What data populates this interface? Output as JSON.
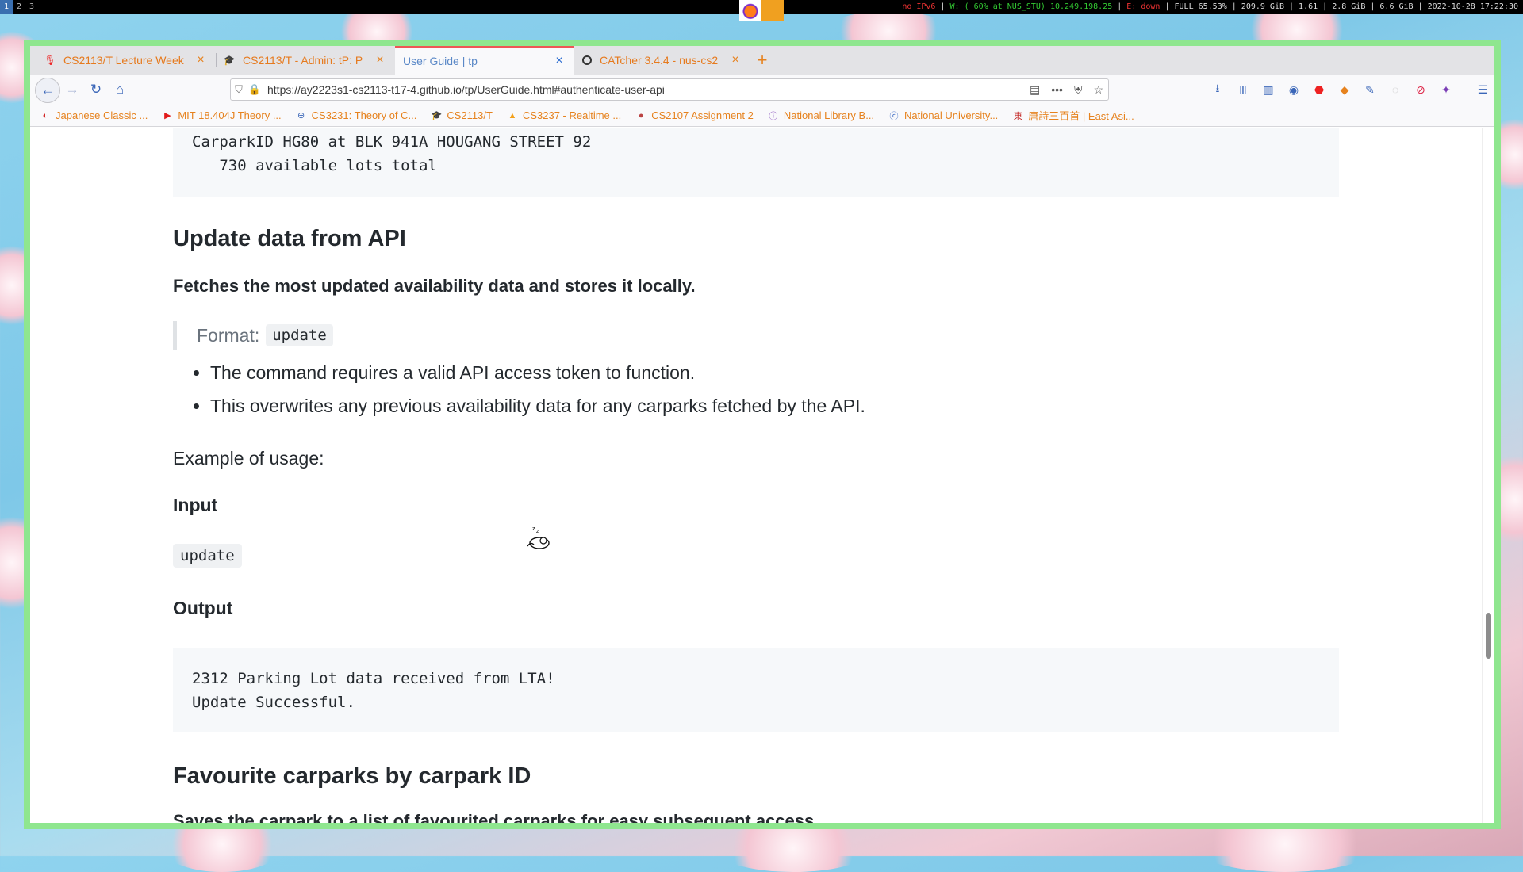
{
  "system_bar": {
    "workspaces": [
      "1",
      "2",
      "3"
    ],
    "active_workspace": "1",
    "status_red_1": "no IPv6",
    "status_green": "W: ( 60% at NUS_STU) 10.249.198.25",
    "status_red_2": "E: down",
    "status_rest": "FULL 65.53% | 209.9 GiB | 1.61 | 2.8 GiB | 6.6 GiB | 2022-10-28 17:22:30"
  },
  "browser": {
    "tabs": [
      {
        "label": "CS2113/T Lecture Week",
        "icon": "microphone-icon"
      },
      {
        "label": "CS2113/T - Admin: tP: P",
        "icon": "graduation-cap-icon"
      },
      {
        "label": "User Guide | tp",
        "icon": "none",
        "active": true
      },
      {
        "label": "CATcher 3.4.4 - nus-cs2",
        "icon": "catcher-icon"
      }
    ],
    "url": "https://ay2223s1-cs2113-t17-4.github.io/tp/UserGuide.html#authenticate-user-api",
    "bookmarks": [
      {
        "label": "Japanese Classic ...",
        "icon": "japan-flag-icon",
        "color": "#d02020"
      },
      {
        "label": "MIT 18.404J Theory ...",
        "icon": "youtube-icon",
        "color": "#e21b1b"
      },
      {
        "label": "CS3231: Theory of C...",
        "icon": "globe-icon",
        "color": "#3a66b8"
      },
      {
        "label": "CS2113/T",
        "icon": "graduation-cap-icon",
        "color": "#2d5fc0"
      },
      {
        "label": "CS3237 - Realtime ...",
        "icon": "firebase-icon",
        "color": "#f4a11b"
      },
      {
        "label": "CS2107 Assignment 2",
        "icon": "pin-icon",
        "color": "#b44"
      },
      {
        "label": "National Library B...",
        "icon": "info-circle-icon",
        "color": "#7a3db5"
      },
      {
        "label": "National University...",
        "icon": "c-logo-icon",
        "color": "#2d5fc0"
      },
      {
        "label": "唐詩三百首 | East Asi...",
        "icon": "chinese-glyph-icon",
        "color": "#c2201e"
      }
    ]
  },
  "page": {
    "top_code": [
      "CarparkID HG80 at BLK 941A HOUGANG STREET 92",
      "   730 available lots total"
    ],
    "section1_title": "Update data from API",
    "section1_lead": "Fetches the most updated availability data and stores it locally.",
    "format_label": "Format:",
    "format_code": "update",
    "notes": [
      "The command requires a valid API access token to function.",
      "This overwrites any previous availability data for any carparks fetched by the API."
    ],
    "example_label": "Example of usage:",
    "input_heading": "Input",
    "input_code": "update",
    "output_heading": "Output",
    "output_code": [
      "2312 Parking Lot data received from LTA!",
      "Update Successful."
    ],
    "section2_title": "Favourite carparks by carpark ID",
    "section2_lead": "Saves the carpark to a list of favourited carparks for easy subsequent access."
  }
}
